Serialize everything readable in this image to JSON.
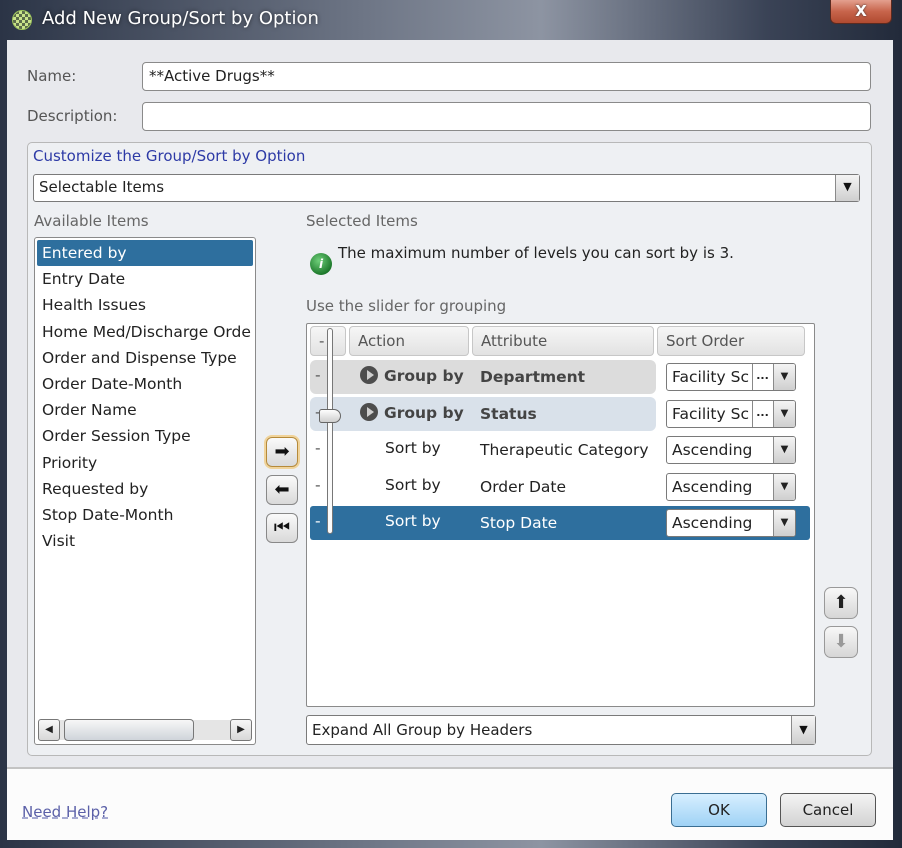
{
  "window": {
    "title": "Add New Group/Sort by Option",
    "close_label": "X"
  },
  "form": {
    "name_label": "Name:",
    "name_value": "**Active Drugs**",
    "description_label": "Description:",
    "description_value": ""
  },
  "customize": {
    "title": "Customize the Group/Sort by Option",
    "item_type_select": "Selectable Items",
    "available_label": "Available Items",
    "selected_label": "Selected Items",
    "available_items": [
      {
        "label": "Entered by",
        "selected": true
      },
      {
        "label": "Entry Date"
      },
      {
        "label": "Health Issues"
      },
      {
        "label": "Home Med/Discharge Orde"
      },
      {
        "label": "Order and Dispense Type"
      },
      {
        "label": "Order Date-Month"
      },
      {
        "label": "Order Name"
      },
      {
        "label": "Order Session Type"
      },
      {
        "label": "Priority"
      },
      {
        "label": "Requested by"
      },
      {
        "label": "Stop Date-Month"
      },
      {
        "label": "Visit"
      }
    ],
    "info_message": "The maximum number of levels you can sort by is 3.",
    "slider_hint": "Use the slider for grouping",
    "grid": {
      "columns": [
        "-",
        "Action",
        "Attribute",
        "Sort Order"
      ],
      "rows": [
        {
          "dash": "-",
          "action": "Group by",
          "attribute": "Department",
          "sort_order": "Facility Sc"
        },
        {
          "dash": "-",
          "action": "Group by",
          "attribute": "Status",
          "sort_order": "Facility Sc"
        },
        {
          "dash": "-",
          "action": "Sort by",
          "attribute": "Therapeutic Category",
          "sort_order": "Ascending"
        },
        {
          "dash": "-",
          "action": "Sort by",
          "attribute": "Order Date",
          "sort_order": "Ascending"
        },
        {
          "dash": "-",
          "action": "Sort by",
          "attribute": "Stop Date",
          "sort_order": "Ascending",
          "selected": true
        }
      ],
      "grouping_level": 2
    },
    "expand_select": "Expand All Group by Headers",
    "ellipsis": "...",
    "icons": {
      "add": "➡",
      "remove": "⬅",
      "remove_all": "⏮",
      "up": "⬆",
      "down": "⬇",
      "dropdown": "▼",
      "scroll_left": "◀",
      "scroll_right": "▶",
      "info": "i"
    }
  },
  "footer": {
    "help_link": "Need Help?",
    "ok_label": "OK",
    "cancel_label": "Cancel"
  }
}
